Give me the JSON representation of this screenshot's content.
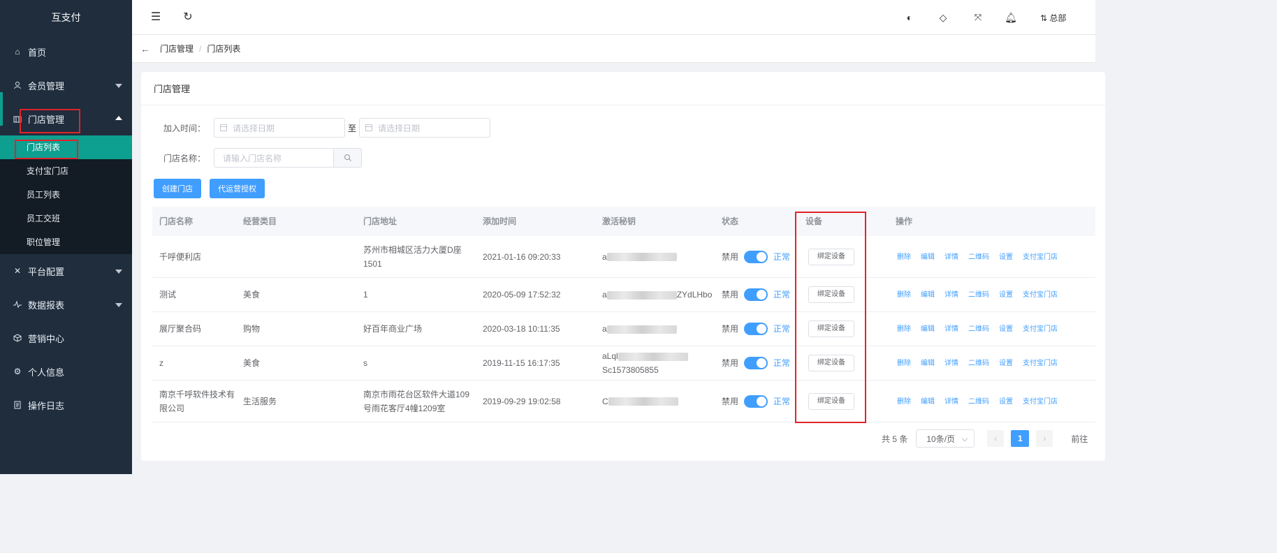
{
  "app": {
    "title": "互支付"
  },
  "sidebar": {
    "items": [
      {
        "label": "首页",
        "icon": "home-icon"
      },
      {
        "label": "会员管理",
        "icon": "user-icon"
      },
      {
        "label": "门店管理",
        "icon": "store-icon"
      },
      {
        "label": "平台配置",
        "icon": "tool-icon"
      },
      {
        "label": "数据报表",
        "icon": "pulse-icon"
      },
      {
        "label": "营销中心",
        "icon": "cube-icon"
      },
      {
        "label": "个人信息",
        "icon": "gear-icon"
      },
      {
        "label": "操作日志",
        "icon": "document-icon"
      }
    ],
    "submenu": [
      "门店列表",
      "支付宝门店",
      "员工列表",
      "员工交班",
      "职位管理"
    ]
  },
  "topbar": {
    "org": "总部"
  },
  "breadcrumb": [
    "门店管理",
    "门店列表"
  ],
  "card": {
    "title": "门店管理"
  },
  "filters": {
    "join_time_label": "加入时间：",
    "date_placeholder": "请选择日期",
    "range_sep": "至",
    "store_name_label": "门店名称：",
    "store_name_placeholder": "请输入门店名称"
  },
  "actions": {
    "create": "创建门店",
    "auth": "代运营授权"
  },
  "table": {
    "headers": [
      "门店名称",
      "经营类目",
      "门店地址",
      "添加时间",
      "激活秘钥",
      "状态",
      "设备",
      "操作"
    ],
    "rows": [
      {
        "name": "千呼便利店",
        "category": "",
        "address": "苏州市相城区活力大厦D座1501",
        "time": "2021-01-16 09:20:33",
        "key_prefix": "a",
        "key_suffix": ""
      },
      {
        "name": "测试",
        "category": "美食",
        "address": "1",
        "time": "2020-05-09 17:52:32",
        "key_prefix": "a",
        "key_suffix": "ZYdLHbo"
      },
      {
        "name": "展厅聚合码",
        "category": "购物",
        "address": "好百年商业广场",
        "time": "2020-03-18 10:11:35",
        "key_prefix": "a",
        "key_suffix": ""
      },
      {
        "name": "z",
        "category": "美食",
        "address": "s",
        "time": "2019-11-15 16:17:35",
        "key_prefix": "aLql",
        "key_suffix": "Sc1573805855"
      },
      {
        "name": "南京千呼软件技术有限公司",
        "category": "生活服务",
        "address": "南京市雨花台区软件大道109号雨花客厅4幢1209室",
        "time": "2019-09-29 19:02:58",
        "key_prefix": "C",
        "key_suffix": ""
      }
    ],
    "status_off": "禁用",
    "status_on": "正常",
    "bind_label": "绑定设备",
    "ops": [
      "删除",
      "编辑",
      "详情",
      "二维码",
      "设置",
      "支付宝门店"
    ]
  },
  "pagination": {
    "total": "共 5 条",
    "page_size": "10条/页",
    "current": "1",
    "goto": "前往"
  },
  "colors": {
    "sidebar_bg": "#1f2d3d",
    "active": "#0d9f8f",
    "primary": "#409eff",
    "highlight": "#e0242b"
  }
}
